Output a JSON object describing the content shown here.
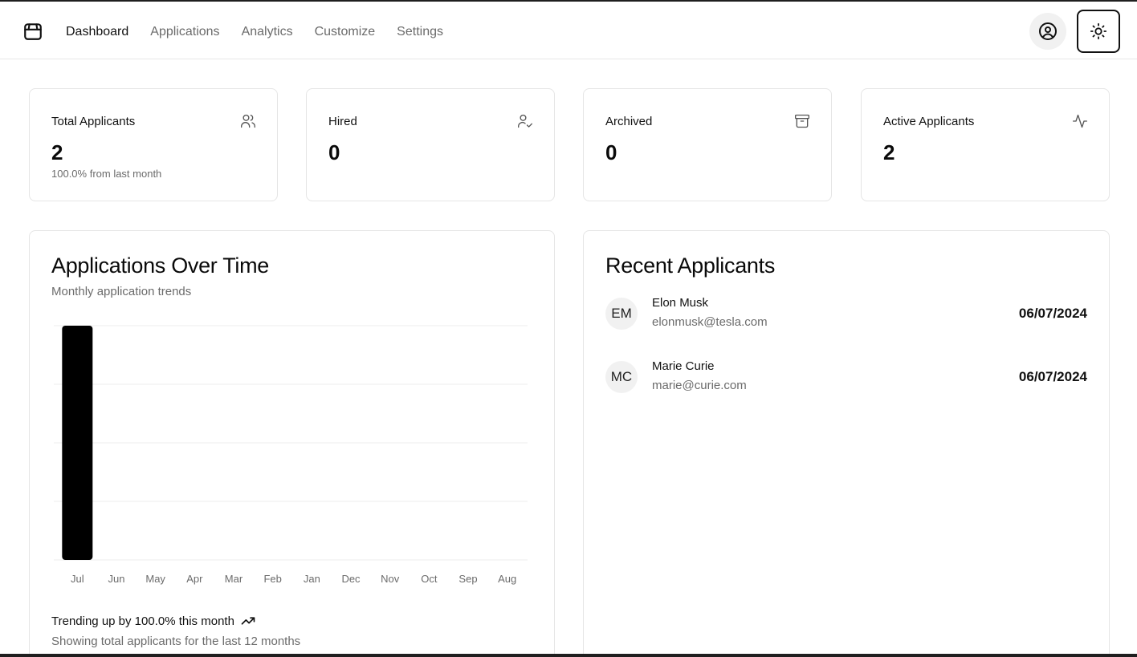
{
  "nav": {
    "items": [
      {
        "label": "Dashboard",
        "active": true
      },
      {
        "label": "Applications",
        "active": false
      },
      {
        "label": "Analytics",
        "active": false
      },
      {
        "label": "Customize",
        "active": false
      },
      {
        "label": "Settings",
        "active": false
      }
    ],
    "logo_icon": "package-icon",
    "account_icon": "user-circle-icon",
    "theme_icon": "sun-icon"
  },
  "stats": [
    {
      "label": "Total Applicants",
      "value": "2",
      "sub": "100.0% from last month",
      "icon": "users-icon"
    },
    {
      "label": "Hired",
      "value": "0",
      "sub": "",
      "icon": "user-check-icon"
    },
    {
      "label": "Archived",
      "value": "0",
      "sub": "",
      "icon": "archive-icon"
    },
    {
      "label": "Active Applicants",
      "value": "2",
      "sub": "",
      "icon": "activity-icon"
    }
  ],
  "chart_card": {
    "title": "Applications Over Time",
    "description": "Monthly application trends",
    "trend_text": "Trending up by 100.0% this month",
    "trend_icon": "trending-up-icon",
    "footer": "Showing total applicants for the last 12 months"
  },
  "chart_data": {
    "type": "bar",
    "categories": [
      "Jul",
      "Jun",
      "May",
      "Apr",
      "Mar",
      "Feb",
      "Jan",
      "Dec",
      "Nov",
      "Oct",
      "Sep",
      "Aug"
    ],
    "values": [
      2,
      0,
      0,
      0,
      0,
      0,
      0,
      0,
      0,
      0,
      0,
      0
    ],
    "ylim": [
      0,
      2
    ],
    "grid": true,
    "bar_color": "#000000"
  },
  "recent": {
    "title": "Recent Applicants",
    "items": [
      {
        "initials": "EM",
        "name": "Elon Musk",
        "email": "elonmusk@tesla.com",
        "date": "06/07/2024"
      },
      {
        "initials": "MC",
        "name": "Marie Curie",
        "email": "marie@curie.com",
        "date": "06/07/2024"
      }
    ]
  }
}
